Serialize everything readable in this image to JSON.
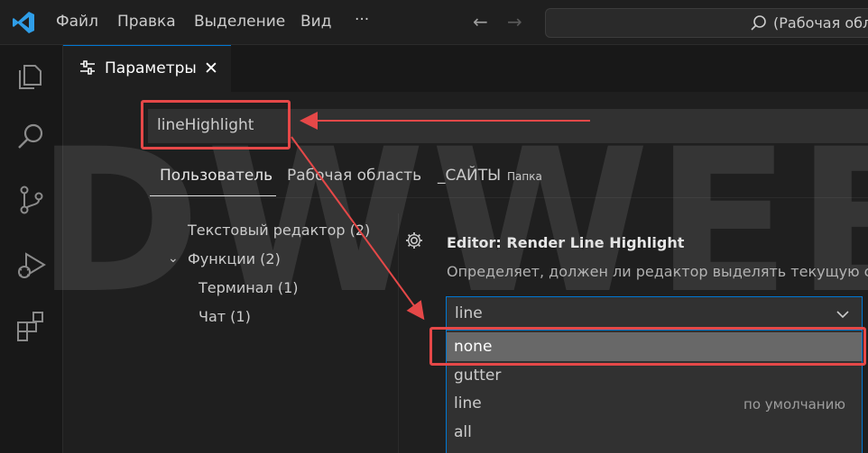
{
  "menubar": {
    "items": [
      "Файл",
      "Правка",
      "Выделение",
      "Вид"
    ],
    "more": "···",
    "back": "←",
    "forward": "→",
    "command_center": "(Рабочая обл"
  },
  "editor_tab": {
    "label": "Параметры",
    "close": "✕"
  },
  "settings": {
    "search_value": "lineHighlight",
    "scopes": [
      "Пользователь",
      "Рабочая область",
      "_САЙТЫ"
    ],
    "scope_badge": "Папка",
    "tree": [
      "Текстовый редактор (2)",
      "Функции (2)",
      "Терминал (1)",
      "Чат (1)"
    ],
    "setting": {
      "category": "Editor: ",
      "name": "Render Line Highlight",
      "description": "Определяет, должен ли редактор выделять текущую с"
    },
    "dropdown": {
      "value": "line",
      "options": [
        {
          "label": "none",
          "hint": ""
        },
        {
          "label": "gutter",
          "hint": ""
        },
        {
          "label": "line",
          "hint": "по умолчанию"
        },
        {
          "label": "all",
          "hint": ""
        }
      ],
      "selected_option": "none"
    },
    "watermark": "DWWEB.RU"
  },
  "colors": {
    "accent": "#0078d4",
    "annotation": "#e54848",
    "selected_option": "#686868"
  }
}
